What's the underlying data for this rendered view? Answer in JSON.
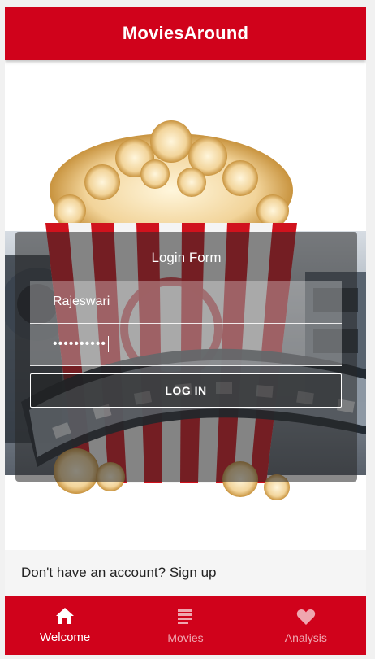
{
  "app": {
    "title": "MoviesAround"
  },
  "login": {
    "title": "Login Form",
    "username_value": "Rajeswari",
    "password_value": "••••••••••",
    "button_label": "LOG IN"
  },
  "signup": {
    "text": "Don't have an account? Sign up"
  },
  "nav": {
    "items": [
      {
        "label": "Welcome",
        "icon": "home-icon",
        "active": true
      },
      {
        "label": "Movies",
        "icon": "list-icon",
        "active": false
      },
      {
        "label": "Analysis",
        "icon": "heart-icon",
        "active": false
      }
    ]
  },
  "colors": {
    "primary": "#d0021b",
    "card_overlay": "#282828"
  }
}
